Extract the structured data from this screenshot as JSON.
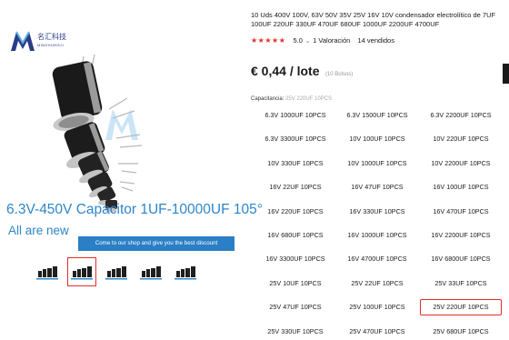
{
  "logo": {
    "text_cn": "名汇科技",
    "text_en": "MINGHUIKEJI",
    "brand_color": "#2b3d8a"
  },
  "gallery": {
    "headline": "6.3V-450V Capacitor 1UF-10000UF 105°",
    "subheadline": "All are new",
    "banner": "Come to our shop and give you the best discount",
    "thumb_count": 5,
    "active_thumb": 1,
    "accent": "#2e86c9"
  },
  "product": {
    "title": "10 Uds 400V 100V, 63V 50V 35V 25V 16V 10V condensador electrolítico de 7UF 100UF 220UF 330UF 470UF 680UF 1000UF 2200UF 4700UF",
    "rating_value": "5.0",
    "rating_count_text": "1 Valoración",
    "sold_text": "14 vendidos",
    "price": "€ 0,44 / lote",
    "price_note": "(10 Bolsos)",
    "capacity_label": "Capacitancia: ",
    "capacity_value": "25V 220UF 10PCS",
    "star_color": "#e32d2d"
  },
  "variants": [
    "6.3V 1000UF 10PCS",
    "6.3V 1500UF 10PCS",
    "6.3V 2200UF 10PCS",
    "6.3V 3300UF 10PCS",
    "10V 100UF 10PCS",
    "10V 220UF 10PCS",
    "10V 330UF 10PCS",
    "10V 1000UF 10PCS",
    "10V 2200UF 10PCS",
    "16V 22UF 10PCS",
    "16V 47UF 10PCS",
    "16V 100UF 10PCS",
    "16V 220UF 10PCS",
    "16V 330UF 10PCS",
    "16V 470UF 10PCS",
    "16V 680UF 10PCS",
    "16V 1000UF 10PCS",
    "16V 2200UF 10PCS",
    "16V 3300UF 10PCS",
    "16V 4700UF 10PCS",
    "16V 6800UF 10PCS",
    "25V 10UF 10PCS",
    "25V 22UF 10PCS",
    "25V 33UF 10PCS",
    "25V 47UF 10PCS",
    "25V 100UF 10PCS",
    "25V 220UF 10PCS",
    "25V 330UF 10PCS",
    "25V 470UF 10PCS",
    "25V 680UF 10PCS"
  ],
  "selected_variant": "25V 220UF 10PCS"
}
